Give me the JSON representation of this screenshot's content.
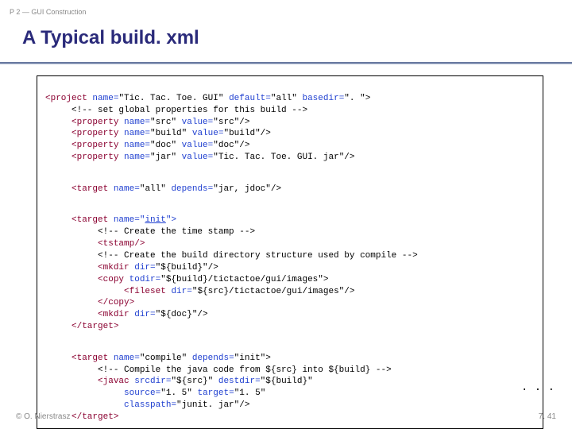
{
  "breadcrumb": "P 2 — GUI Construction",
  "title": "A Typical build. xml",
  "code": {
    "block1": {
      "l1a": "<project ",
      "l1b": "name=",
      "l1c": "\"Tic. Tac. Toe. GUI\" ",
      "l1d": "default=",
      "l1e": "\"all\" ",
      "l1f": "basedir=",
      "l1g": "\". \">",
      "l2": "     <!-- set global properties for this build -->",
      "l3a": "     <property ",
      "l3b": "name=",
      "l3c": "\"src\" ",
      "l3d": "value=",
      "l3e": "\"src\"/>",
      "l4a": "     <property ",
      "l4b": "name=",
      "l4c": "\"build\" ",
      "l4d": "value=",
      "l4e": "\"build\"/>",
      "l5a": "     <property ",
      "l5b": "name=",
      "l5c": "\"doc\" ",
      "l5d": "value=",
      "l5e": "\"doc\"/>",
      "l6a": "     <property ",
      "l6b": "name=",
      "l6c": "\"jar\" ",
      "l6d": "value=",
      "l6e": "\"Tic. Tac. Toe. GUI. jar\"/>"
    },
    "block2": {
      "l1a": "     <target ",
      "l1b": "name=",
      "l1c": "\"all\" ",
      "l1d": "depends=",
      "l1e": "\"jar, jdoc\"/>"
    },
    "block3": {
      "l1a": "     <target ",
      "l1b": "name=\"",
      "l1c": "init",
      "l1d": "\">",
      "l2": "          <!-- Create the time stamp -->",
      "l3": "          <tstamp/>",
      "l4": "          <!-- Create the build directory structure used by compile -->",
      "l5a": "          <mkdir ",
      "l5b": "dir=",
      "l5c": "\"${build}\"/>",
      "l6a": "          <copy ",
      "l6b": "todir=",
      "l6c": "\"${build}/tictactoe/gui/images\">",
      "l7a": "               <fileset ",
      "l7b": "dir=",
      "l7c": "\"${src}/tictactoe/gui/images\"/>",
      "l8": "          </copy>",
      "l9a": "          <mkdir ",
      "l9b": "dir=",
      "l9c": "\"${doc}\"/>",
      "l10": "     </target>"
    },
    "block4": {
      "l1a": "     <target ",
      "l1b": "name=",
      "l1c": "\"compile\" ",
      "l1d": "depends=",
      "l1e": "\"init\">",
      "l2": "          <!-- Compile the java code from ${src} into ${build} -->",
      "l3a": "          <javac ",
      "l3b": "srcdir=",
      "l3c": "\"${src}\" ",
      "l3d": "destdir=",
      "l3e": "\"${build}\"",
      "l4a": "               ",
      "l4b": "source=",
      "l4c": "\"1. 5\" ",
      "l4d": "target=",
      "l4e": "\"1. 5\"",
      "l5a": "               ",
      "l5b": "classpath=",
      "l5c": "\"junit. jar\"/>",
      "l6": "     </target>"
    }
  },
  "ellipsis": ". . .",
  "footer": {
    "left": "© O. Nierstrasz",
    "right": "7. 41"
  }
}
